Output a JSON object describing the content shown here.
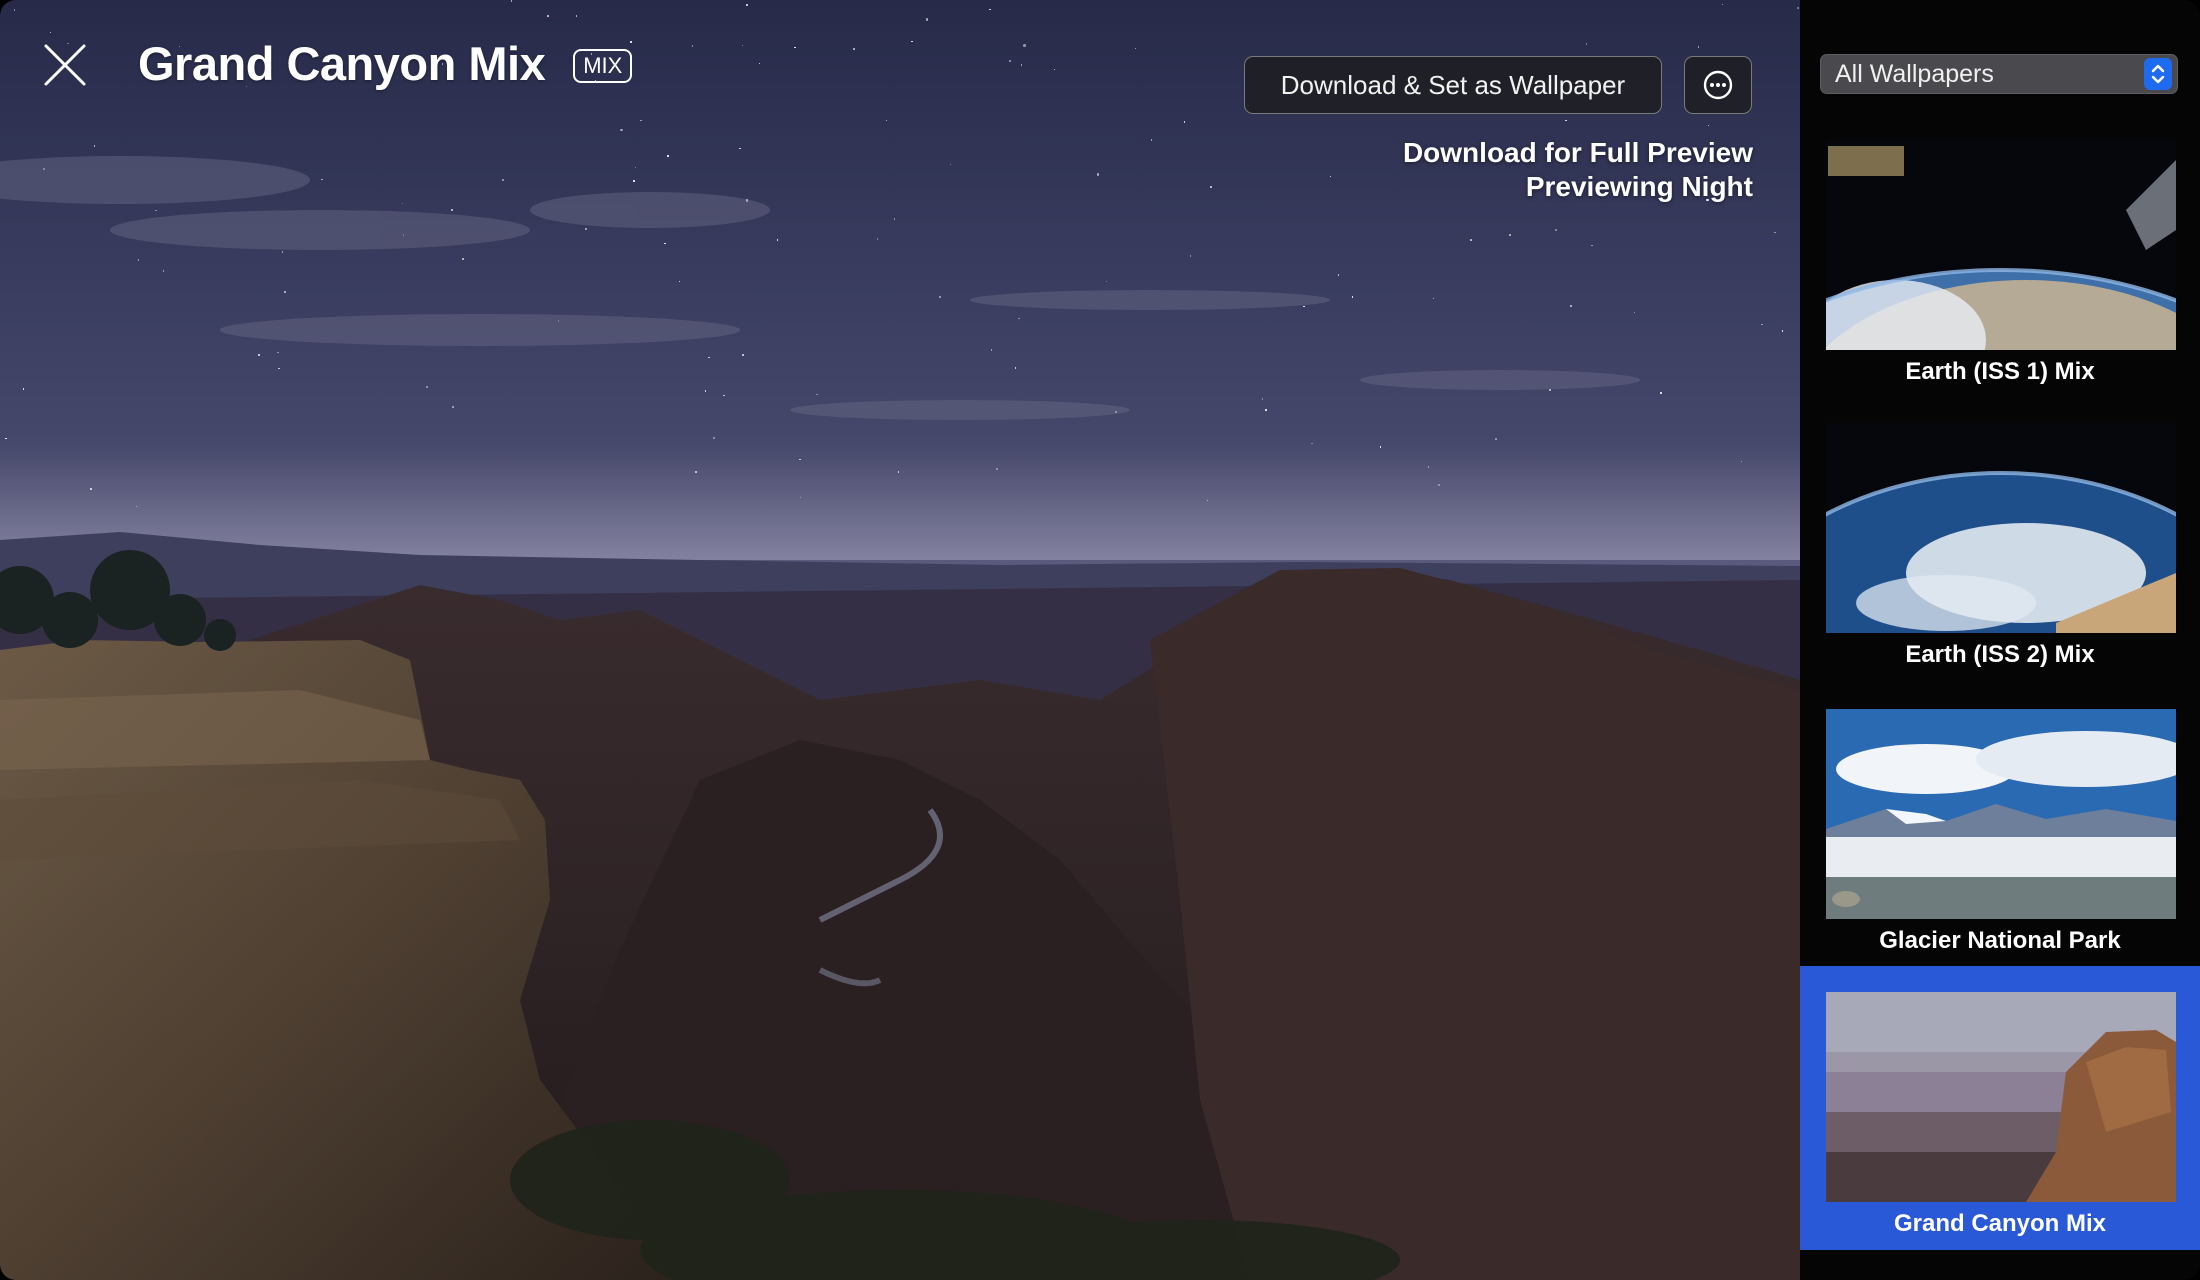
{
  "window": {
    "title": "Grand Canyon Mix",
    "badge": "MIX"
  },
  "toolbar": {
    "primary_button_label": "Download & Set as Wallpaper",
    "more_button_icon": "ellipsis-circle-icon",
    "close_icon": "close-icon"
  },
  "preview": {
    "line1": "Download for Full Preview",
    "line2": "Previewing Night"
  },
  "sidebar": {
    "filter": {
      "value": "All Wallpapers",
      "icon": "chevron-up-down-icon"
    },
    "items": [
      {
        "label": "Earth (ISS 1) Mix",
        "selected": false
      },
      {
        "label": "Earth (ISS 2) Mix",
        "selected": false
      },
      {
        "label": "Glacier National Park",
        "selected": false
      },
      {
        "label": "Grand Canyon Mix",
        "selected": true
      }
    ]
  },
  "colors": {
    "selection": "#2a59d8",
    "select_arrows": "#1f6bf0"
  }
}
